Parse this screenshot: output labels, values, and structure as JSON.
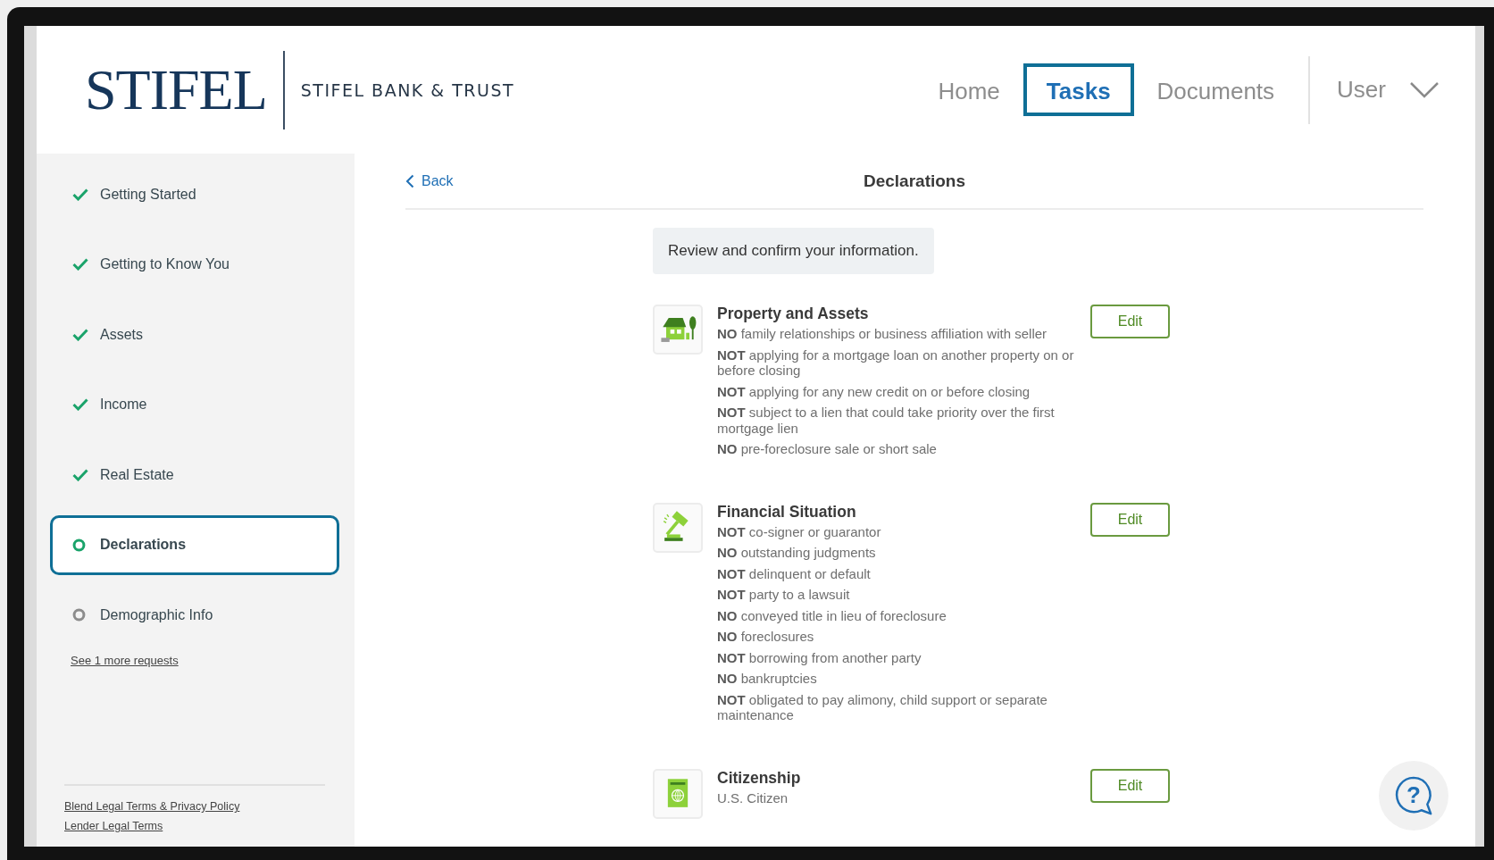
{
  "header": {
    "logo": "STIFEL",
    "logo_subtitle": "STIFEL BANK & TRUST",
    "nav": [
      {
        "label": "Home",
        "selected": false
      },
      {
        "label": "Tasks",
        "selected": true
      },
      {
        "label": "Documents",
        "selected": false
      }
    ],
    "user_menu": {
      "label": "User",
      "expanded": false
    }
  },
  "sidebar": {
    "steps": [
      {
        "label": "Getting Started",
        "kind": "complete",
        "selected": false
      },
      {
        "label": "Getting to Know You",
        "kind": "complete",
        "selected": false
      },
      {
        "label": "Assets",
        "kind": "complete",
        "selected": false
      },
      {
        "label": "Income",
        "kind": "complete",
        "selected": false
      },
      {
        "label": "Real Estate",
        "kind": "complete",
        "selected": false
      },
      {
        "label": "Declarations",
        "kind": "current",
        "selected": true
      },
      {
        "label": "Demographic Info",
        "kind": "pending",
        "selected": false
      }
    ],
    "more_link": "See 1 more requests",
    "legal_links": [
      "Blend Legal Terms & Privacy Policy",
      "Lender Legal Terms"
    ]
  },
  "content": {
    "back": "Back",
    "title": "Declarations",
    "banner": "Review and confirm your information.",
    "sections": [
      {
        "title": "Property and Assets",
        "kind": "house",
        "button": "Edit",
        "lines": [
          "**NO** family relationships or business affiliation with seller",
          "**NOT** applying for a mortgage loan on another property on or before closing",
          "**NOT** applying for any new credit on or before closing",
          "**NOT** subject to a lien that could take priority over the first mortgage lien",
          "**NO** pre-foreclosure sale or short sale"
        ]
      },
      {
        "title": "Financial Situation",
        "kind": "gavel",
        "button": "Edit",
        "lines": [
          "**NOT** co-signer or guarantor",
          "**NO** outstanding judgments",
          "**NOT** delinquent or default",
          "**NOT** party to a lawsuit",
          "**NO** conveyed title in lieu of foreclosure",
          "**NO** foreclosures",
          "**NOT** borrowing from another party",
          "**NO** bankruptcies",
          "**NOT** obligated to pay alimony, child support or separate maintenance"
        ]
      },
      {
        "title": "Citizenship",
        "kind": "passport",
        "button": "Edit",
        "lines": [
          "U.S. Citizen"
        ]
      }
    ]
  },
  "help_button": {
    "label": "?"
  }
}
